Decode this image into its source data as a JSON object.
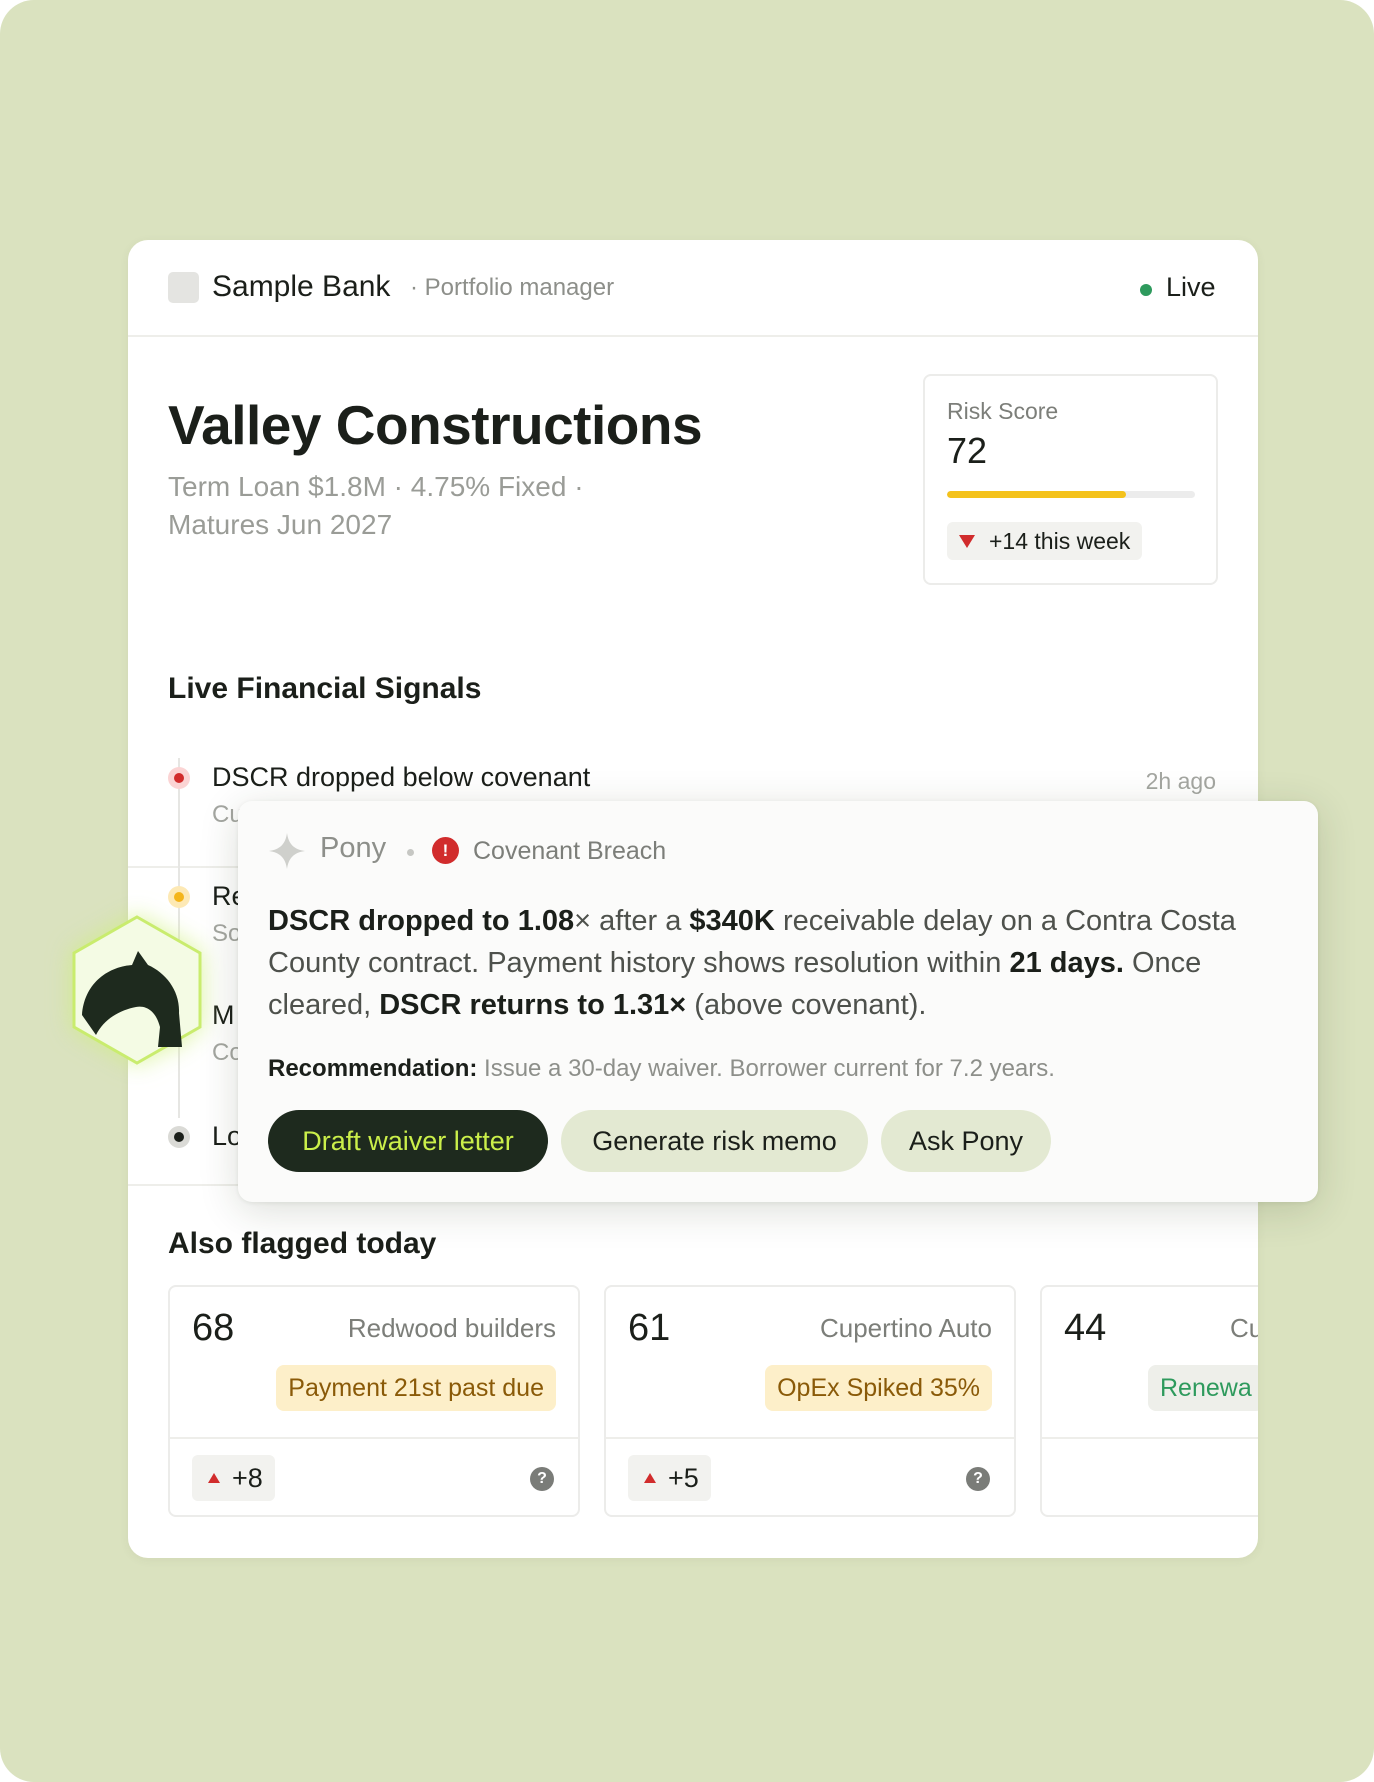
{
  "header": {
    "bank_name": "Sample Bank",
    "role": "· Portfolio manager",
    "status": "Live",
    "status_color": "#2e9a5d"
  },
  "borrower": {
    "name": "Valley Constructions",
    "loan_line1": "Term Loan $1.8M · 4.75% Fixed ·",
    "loan_line2": "Matures Jun 2027"
  },
  "risk": {
    "label": "Risk Score",
    "value": "72",
    "bar_level": 0.72,
    "change": "+14 this week"
  },
  "signals": {
    "title": "Live Financial Signals",
    "items": [
      {
        "title": "DSCR dropped below covenant",
        "sub": "Cu",
        "time": "2h ago",
        "status": "red"
      },
      {
        "title": "Re",
        "sub": "So",
        "status": "yellow"
      },
      {
        "title": "M",
        "sub": "Co",
        "status": "gray"
      },
      {
        "title": "Lo",
        "status": "dark"
      }
    ]
  },
  "popup": {
    "assistant": "Pony",
    "category": "Covenant Breach",
    "alert_icon": "!",
    "body_b1": "DSCR dropped to 1.08",
    "body_t1": "× after a ",
    "body_b2": "$340K",
    "body_t2": " receivable delay on a Contra Costa County contract. Payment history shows resolution within ",
    "body_b3": "21 days.",
    "body_t3": " Once cleared, ",
    "body_b4": "DSCR returns to 1.31×",
    "body_t4": " (above covenant).",
    "rec_label": "Recommendation:",
    "rec_text": " Issue a 30-day waiver. Borrower current for 7.2 years.",
    "buttons": [
      "Draft waiver letter",
      "Generate risk memo",
      "Ask Pony"
    ]
  },
  "flagged": {
    "title": "Also flagged today",
    "cards": [
      {
        "score": "68",
        "name": "Redwood builders",
        "tag": "Payment 21st past due",
        "delta": "+8",
        "help": "?"
      },
      {
        "score": "61",
        "name": "Cupertino Auto",
        "tag": "OpEx Spiked 35%",
        "delta": "+5",
        "help": "?"
      },
      {
        "score": "44",
        "name": "Cu",
        "tag": "Renewa"
      }
    ]
  },
  "colors": {
    "background": "#dae2bf",
    "accent_dark": "#1e2a1e",
    "accent_lime": "#cbef4a",
    "risk_bar": "#f4c21b",
    "alert_red": "#d12c2c"
  },
  "icons": [
    "sparkle-icon",
    "alert-icon",
    "horse-logo-icon",
    "triangle-down-icon",
    "triangle-up-icon",
    "help-icon"
  ]
}
